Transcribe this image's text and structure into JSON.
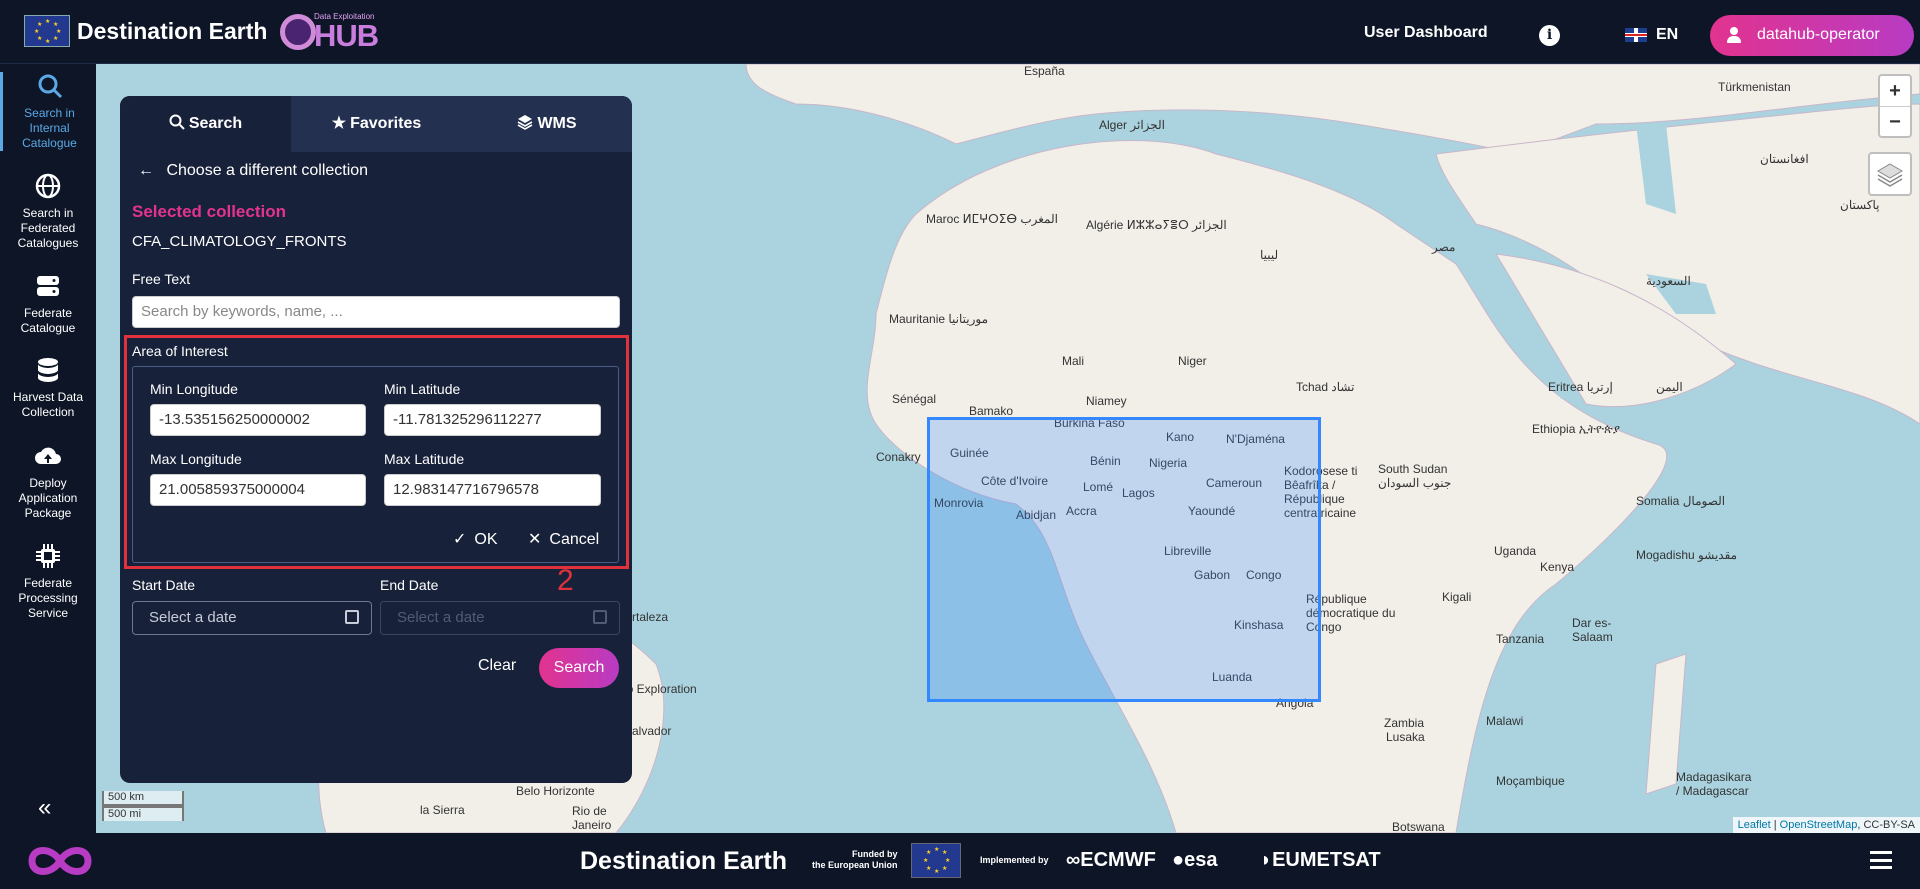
{
  "header": {
    "brand": "Destination Earth",
    "hub_subtitle": "Data Exploitation",
    "hub_text": "HUB",
    "user_dashboard": "User Dashboard",
    "info_icon": "info-icon",
    "language": "EN",
    "user": "datahub-operator"
  },
  "sidebar": {
    "items": [
      {
        "label": "Search in Internal Catalogue",
        "icon": "search-icon",
        "active": true
      },
      {
        "label": "Search in Federated Catalogues",
        "icon": "globe-icon"
      },
      {
        "label": "Federate Catalogue",
        "icon": "server-icon"
      },
      {
        "label": "Harvest Data Collection",
        "icon": "database-icon"
      },
      {
        "label": "Deploy Application Package",
        "icon": "cloud-upload-icon"
      },
      {
        "label": "Federate Processing Service",
        "icon": "chip-icon"
      }
    ],
    "collapse": "«"
  },
  "panel": {
    "tabs": [
      {
        "label": "Search",
        "icon": "search-icon",
        "active": true
      },
      {
        "label": "Favorites",
        "icon": "star-icon"
      },
      {
        "label": "WMS",
        "icon": "layers-icon"
      }
    ],
    "back_label": "Choose a different collection",
    "selected_title": "Selected collection",
    "selected_value": "CFA_CLIMATOLOGY_FRONTS",
    "free_text_label": "Free Text",
    "free_text_placeholder": "Search by keywords, name, ...",
    "aoi_label": "Area of Interest",
    "min_lon_label": "Min Longitude",
    "min_lon_value": "-13.535156250000002",
    "min_lat_label": "Min Latitude",
    "min_lat_value": "-11.781325296112277",
    "max_lon_label": "Max Longitude",
    "max_lon_value": "21.005859375000004",
    "max_lat_label": "Max Latitude",
    "max_lat_value": "12.983147716796578",
    "ok_label": "OK",
    "cancel_label": "Cancel",
    "annotation_number": "2",
    "start_date_label": "Start Date",
    "start_date_placeholder": "Select a date",
    "end_date_label": "End Date",
    "end_date_placeholder": "Select a date",
    "clear_label": "Clear",
    "search_label": "Search"
  },
  "map": {
    "zoom_in": "+",
    "zoom_out": "−",
    "scale_km": "500 km",
    "scale_mi": "500 mi",
    "attribution_leaflet": "Leaflet",
    "attribution_sep": " | ",
    "attribution_osm": "OpenStreetMap",
    "attribution_license": ", CC-BY-SA",
    "labels": [
      "España",
      "Alger الجزائر",
      "Maroc ⵍⵎⵖⵔⵉⴱ المغرب",
      "Algérie ⵍⵣⵣⴰⵢⴻⵔ الجزائر",
      "ليبيا",
      "مصر",
      "Mauritanie موريتانيا",
      "Mali",
      "Niger",
      "Tchad تشاد",
      "Sénégal",
      "Bamako",
      "Niamey",
      "Conakry",
      "Guinée",
      "Burkina Faso",
      "Bénin",
      "Nigeria",
      "Kano",
      "N'Djaména",
      "Côte d'Ivoire",
      "Monrovia",
      "Abidjan",
      "Accra",
      "Lomé",
      "Lagos",
      "Yaoundé",
      "Cameroun",
      "Kodorosese ti Bêafrîka / République centrafricaine",
      "Libreville",
      "Gabon",
      "Congo",
      "République démocratique du Congo",
      "Kinshasa",
      "Luanda",
      "Angola",
      "South Sudan جنوب السودان",
      "Ethiopia ኢትዮጵያ",
      "Somalia الصومال",
      "Uganda",
      "Kenya",
      "Kigali",
      "Tanzania",
      "Dar es-Salaam",
      "Zambia",
      "Malawi",
      "Lusaka",
      "Moçambique",
      "Madagasikara / Madagascar",
      "Botswana",
      "Mogadishu مقديشو",
      "Eritrea إرتريا",
      "اليمن",
      "السعودية",
      "Türkmenistan",
      "افغانستان",
      "پاکستان",
      "Belo Horizonte",
      "Rio de Janeiro",
      "alvador",
      "lo Exploration",
      "la Sierra",
      "rtaleza"
    ]
  },
  "footer": {
    "brand": "Destination Earth",
    "funded_line1": "Funded by",
    "funded_line2": "the European Union",
    "implemented": "Implemented by",
    "partner1": "ECMWF",
    "partner2": "esa",
    "partner3": "EUMETSAT"
  },
  "colors": {
    "accent_pink": "#e2338f",
    "accent_blue": "#5aa9e6",
    "highlight_red": "#e0323c",
    "panel_bg": "#18213a",
    "bbox_blue": "#3388ff"
  }
}
